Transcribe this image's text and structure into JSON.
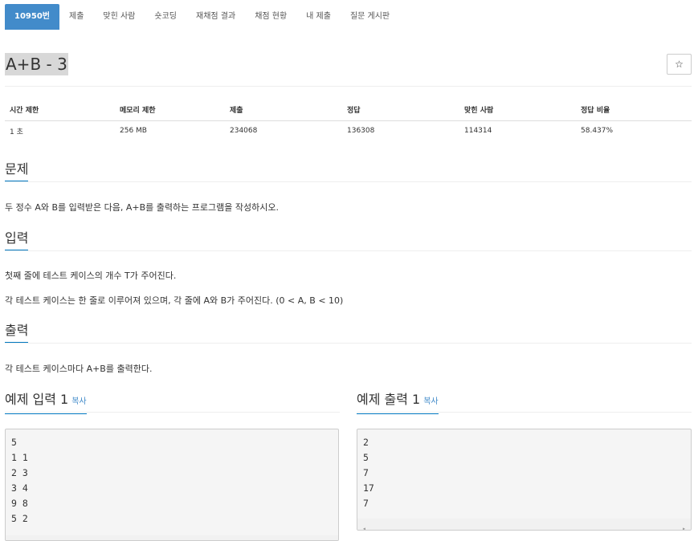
{
  "tabs": [
    "10950번",
    "제출",
    "맞힌 사람",
    "숏코딩",
    "재채점 결과",
    "채점 현황",
    "내 제출",
    "질문 게시판"
  ],
  "title": "A+B - 3",
  "star_icon": "☆",
  "info": {
    "headers": [
      "시간 제한",
      "메모리 제한",
      "제출",
      "정답",
      "맞힌 사람",
      "정답 비율"
    ],
    "values": [
      "1 초",
      "256 MB",
      "234068",
      "136308",
      "114314",
      "58.437%"
    ]
  },
  "sections": {
    "problem": {
      "title": "문제",
      "text": "두 정수 A와 B를 입력받은 다음, A+B를 출력하는 프로그램을 작성하시오."
    },
    "input": {
      "title": "입력",
      "text1": "첫째 줄에 테스트 케이스의 개수 T가 주어진다.",
      "text2": "각 테스트 케이스는 한 줄로 이루어져 있으며, 각 줄에 A와 B가 주어진다. (0 < A, B < 10)"
    },
    "output": {
      "title": "출력",
      "text": "각 테스트 케이스마다 A+B를 출력한다."
    }
  },
  "sample_input": {
    "title": "예제 입력 1",
    "copy": "복사",
    "lines": [
      "5",
      "1 1",
      "2 3",
      "3 4",
      "9 8",
      "5 2"
    ]
  },
  "sample_output": {
    "title": "예제 출력 1",
    "copy": "복사",
    "lines": [
      "2",
      "5",
      "7",
      "17",
      "7"
    ]
  },
  "scroll_icons": {
    "left": "◂",
    "right": "▸"
  }
}
